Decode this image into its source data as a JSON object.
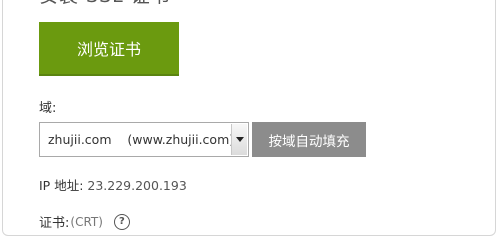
{
  "section": {
    "heading": "安装 SSL 证书"
  },
  "buttons": {
    "browse_certificate": "浏览证书",
    "autofill_by_domain": "按域自动填充"
  },
  "domain": {
    "label": "域:",
    "selected_value": "zhujii.com    (www.zhujii.com)"
  },
  "ip": {
    "label": "IP 地址",
    "separator": ": ",
    "value": "23.229.200.193"
  },
  "certificate": {
    "label": "证书:",
    "suffix": "(CRT)",
    "help_glyph": "?"
  },
  "icons": {
    "dropdown": "chevron-down-icon",
    "help": "question-circle-icon"
  },
  "colors": {
    "primary_button": "#6b9a0f",
    "secondary_button": "#8c8c8c"
  }
}
